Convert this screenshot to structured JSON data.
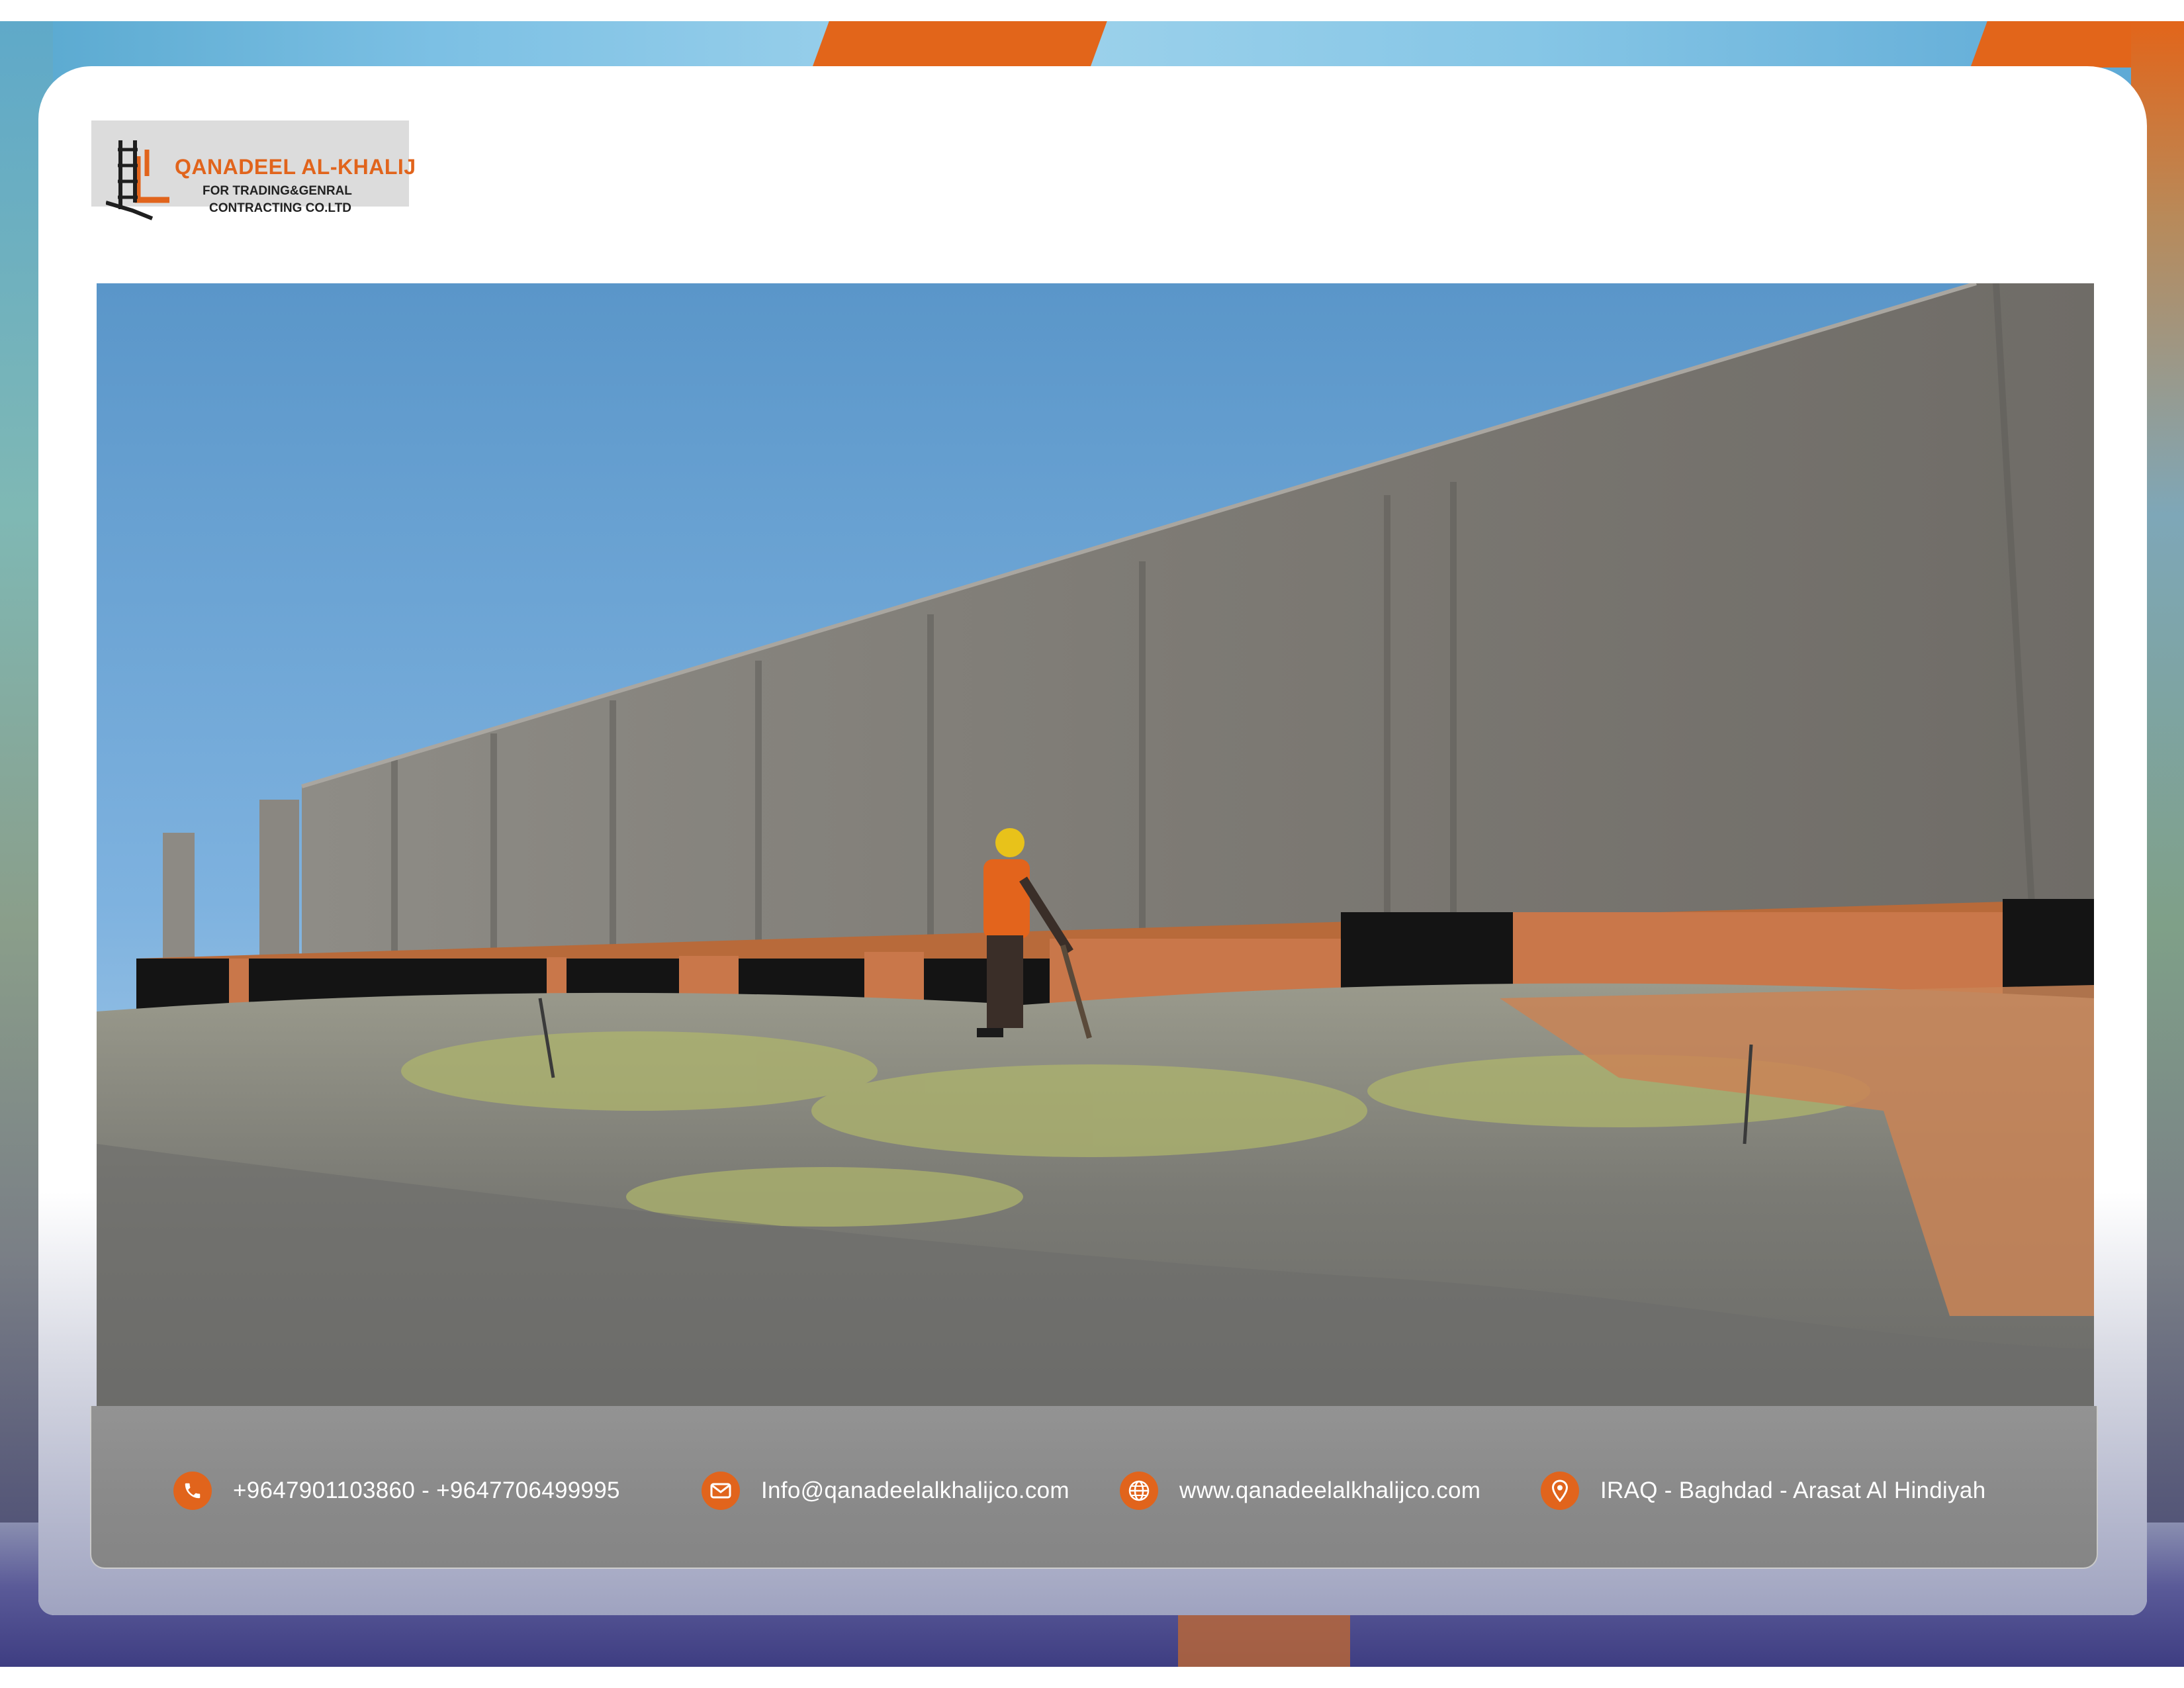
{
  "logo": {
    "title": "QANADEEL AL-KHALIJ",
    "subtitle_line1": "FOR TRADING&GENRAL",
    "subtitle_line2": "CONTRACTING CO.LTD"
  },
  "photo": {
    "subject": "construction-site-concrete-wall"
  },
  "contact": {
    "phone": "+9647901103860  -  +9647706499995",
    "email": "Info@qanadeelalkhalijco.com",
    "website": "www.qanadeelalkhalijco.com",
    "address": "IRAQ - Baghdad - Arasat Al Hindiyah"
  },
  "colors": {
    "accent": "#e1641c",
    "bar": "#8c8c8c",
    "card": "#ffffff"
  },
  "icons": [
    "phone-icon",
    "email-icon",
    "globe-icon",
    "location-pin-icon"
  ]
}
